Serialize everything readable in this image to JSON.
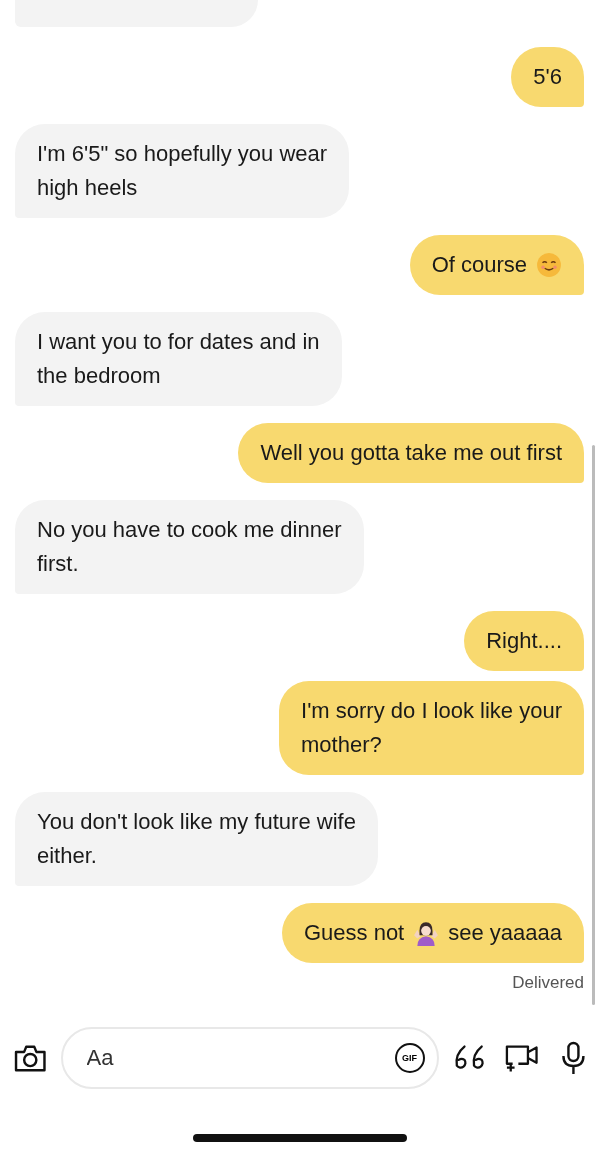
{
  "messages": [
    {
      "kind": "sent",
      "lines": [
        "5'6"
      ]
    },
    {
      "kind": "received",
      "lines": [
        "I'm 6'5\" so hopefully you wear",
        "high heels"
      ]
    },
    {
      "kind": "sent",
      "lines": [
        "Of course"
      ],
      "parts": [
        {
          "kind": "smile-emoji"
        }
      ]
    },
    {
      "kind": "received",
      "lines": [
        "I want you to for dates and in",
        "the bedroom"
      ]
    },
    {
      "kind": "sent",
      "lines": [
        "Well you gotta take me out first"
      ]
    },
    {
      "kind": "received",
      "lines": [
        "No you have to cook me dinner",
        "first."
      ]
    },
    {
      "kind": "sent",
      "lines": [
        "Right...."
      ]
    },
    {
      "kind": "sent",
      "lines": [
        "I'm sorry do I look like your",
        "mother?"
      ]
    },
    {
      "kind": "received",
      "lines": [
        "You don't look like my future wife",
        "either."
      ]
    },
    {
      "kind": "sent",
      "lines": [
        "Guess not"
      ],
      "parts": [
        {
          "kind": "shrug-emoji"
        },
        {
          "kind": "text",
          "text": "see yaaaaa"
        }
      ]
    }
  ],
  "status": "Delivered",
  "composer": {
    "placeholder": "Aa",
    "gif_label": "GIF"
  }
}
